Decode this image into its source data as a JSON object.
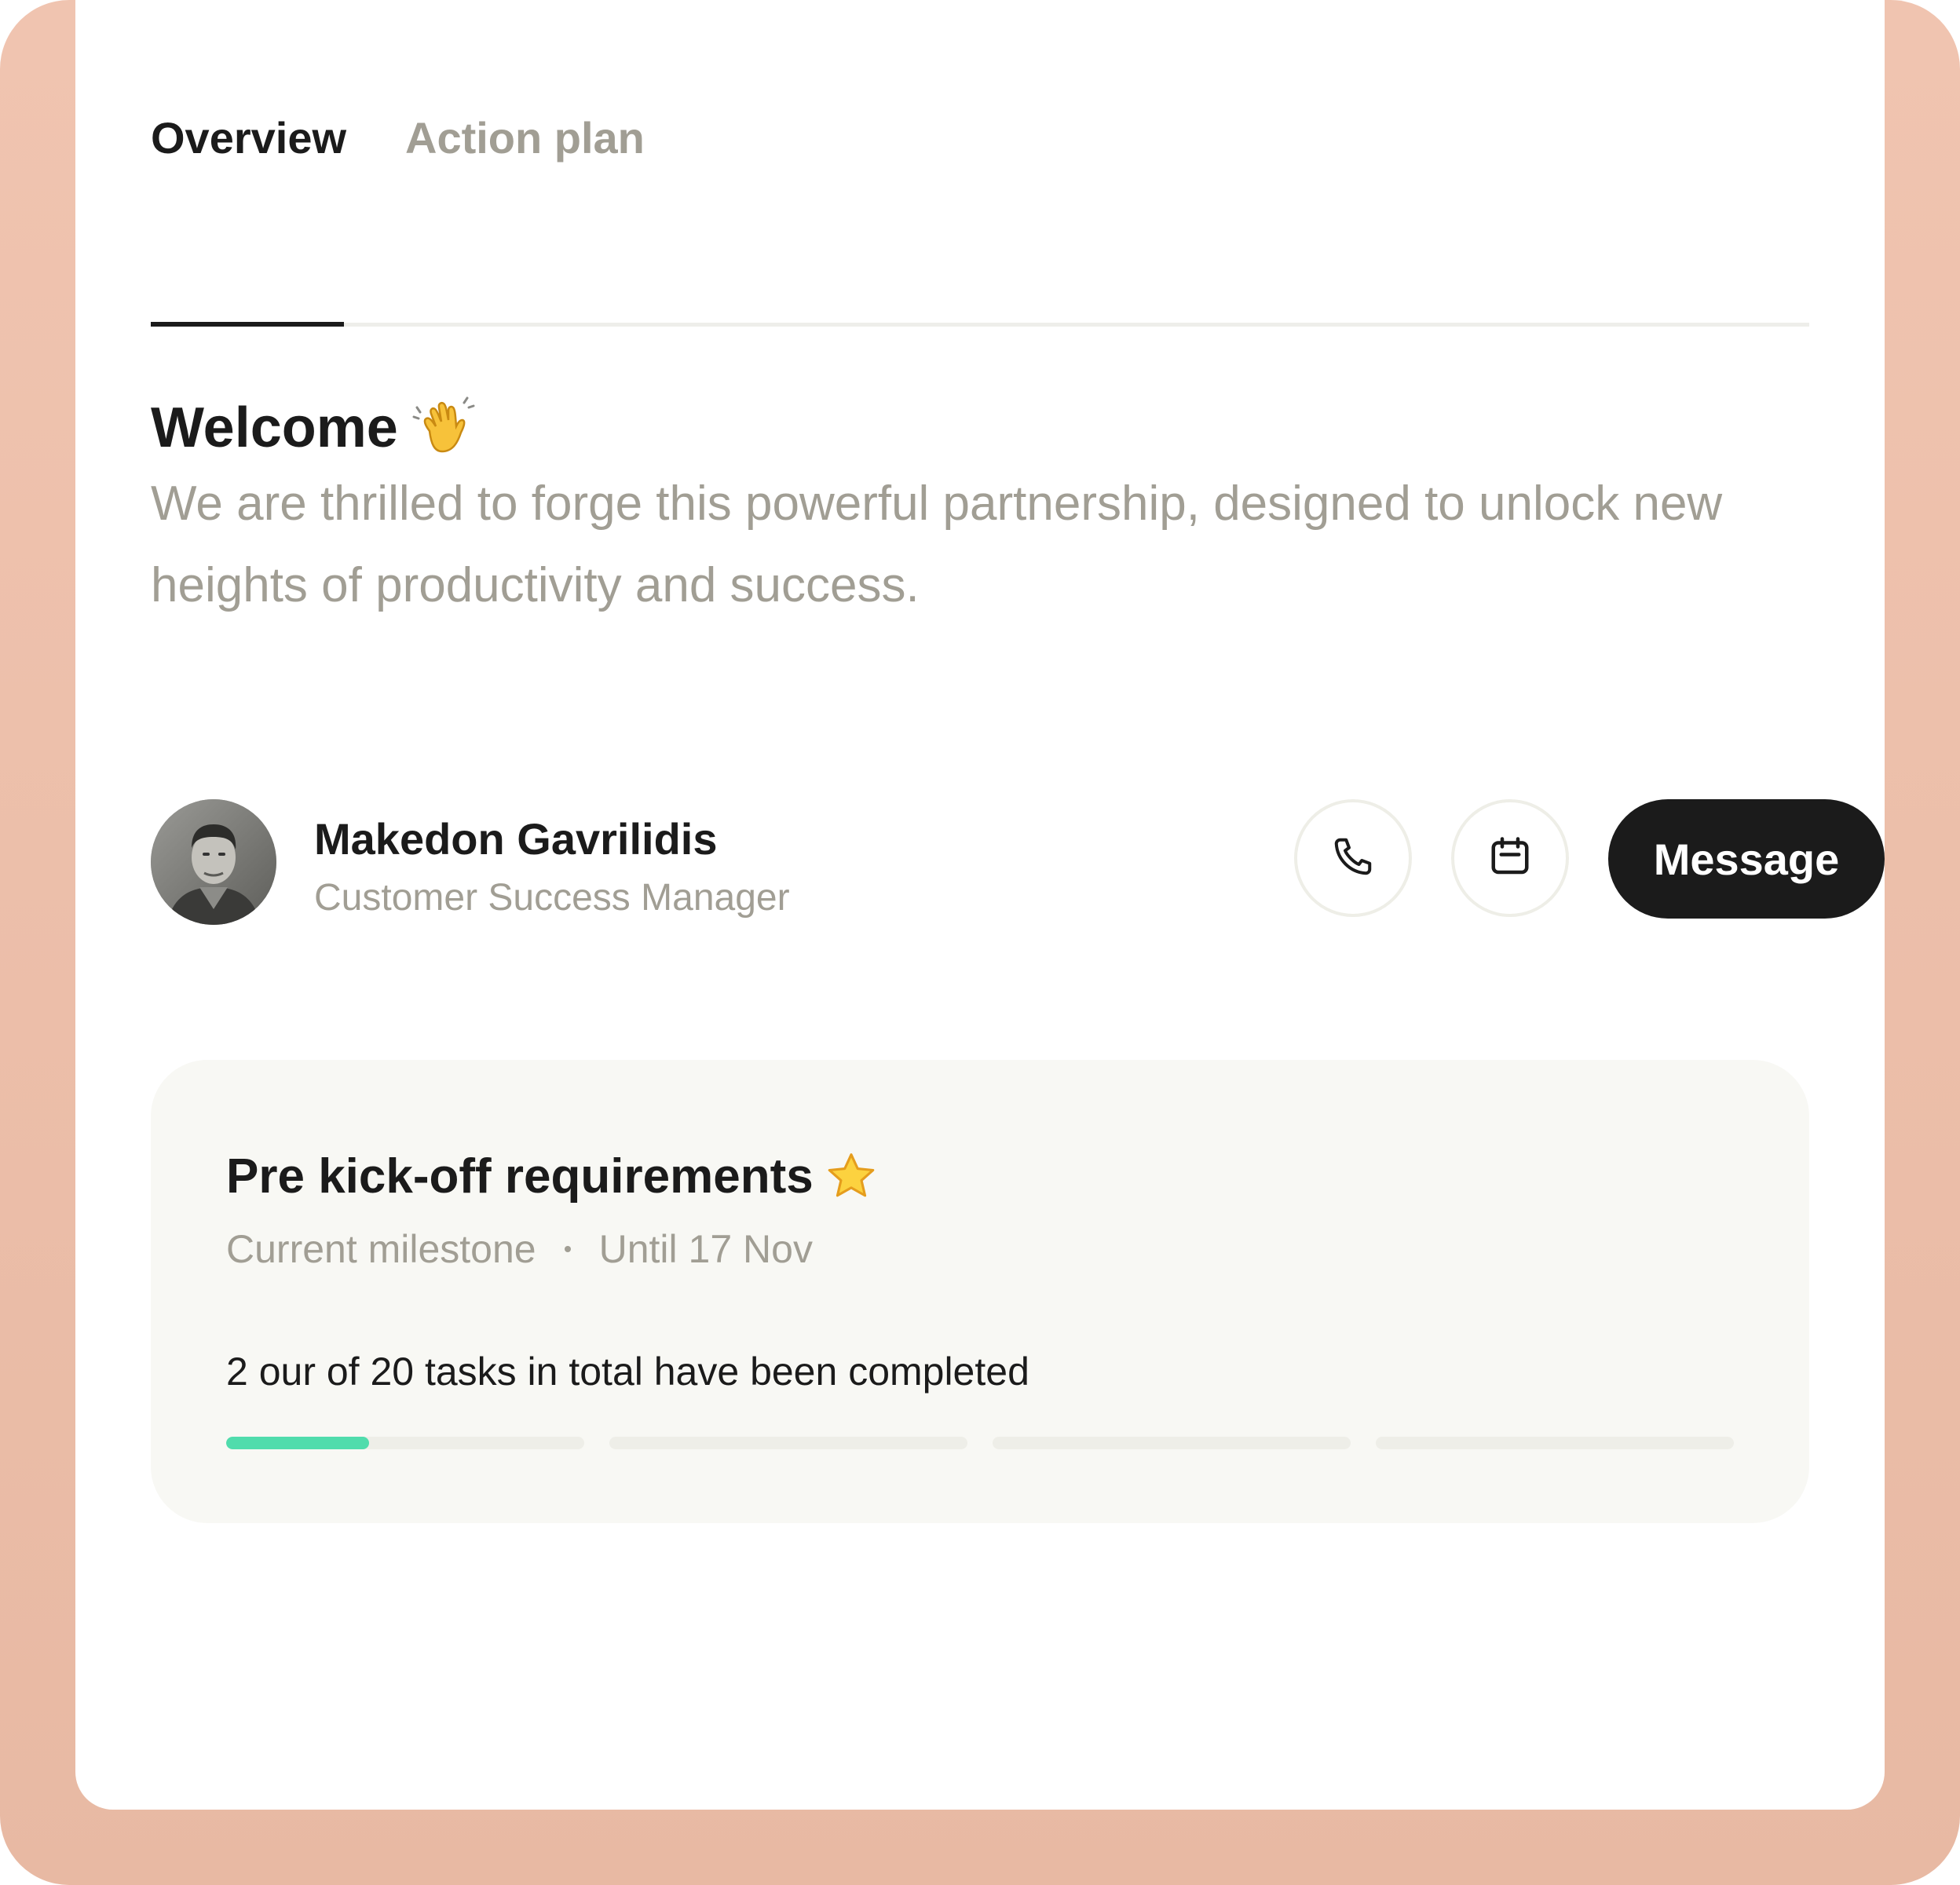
{
  "tabs": [
    {
      "label": "Overview",
      "active": true
    },
    {
      "label": "Action plan",
      "active": false
    }
  ],
  "welcome": {
    "title": "Welcome",
    "icon": "waving-hand-icon",
    "body": "We are thrilled to forge this powerful partnership, designed to unlock new heights of productivity and success."
  },
  "contact": {
    "name": "Makedon Gavrilidis",
    "role": "Customer Success Manager",
    "avatar_icon": "avatar",
    "actions": {
      "phone_icon": "phone-icon",
      "calendar_icon": "calendar-icon",
      "message_label": "Message"
    }
  },
  "milestone": {
    "title": "Pre kick-off requirements",
    "icon": "star-icon",
    "status": "Current milestone",
    "deadline": "Until 17 Nov",
    "progress_text": "2 our of 20 tasks in total have been completed",
    "completed": 2,
    "total": 20,
    "segments": 4
  },
  "colors": {
    "frame": "#efc2ae",
    "text_primary": "#1b1b1b",
    "text_muted": "#a19e94",
    "accent_progress": "#50dcac",
    "card_bg": "#f8f8f4"
  }
}
